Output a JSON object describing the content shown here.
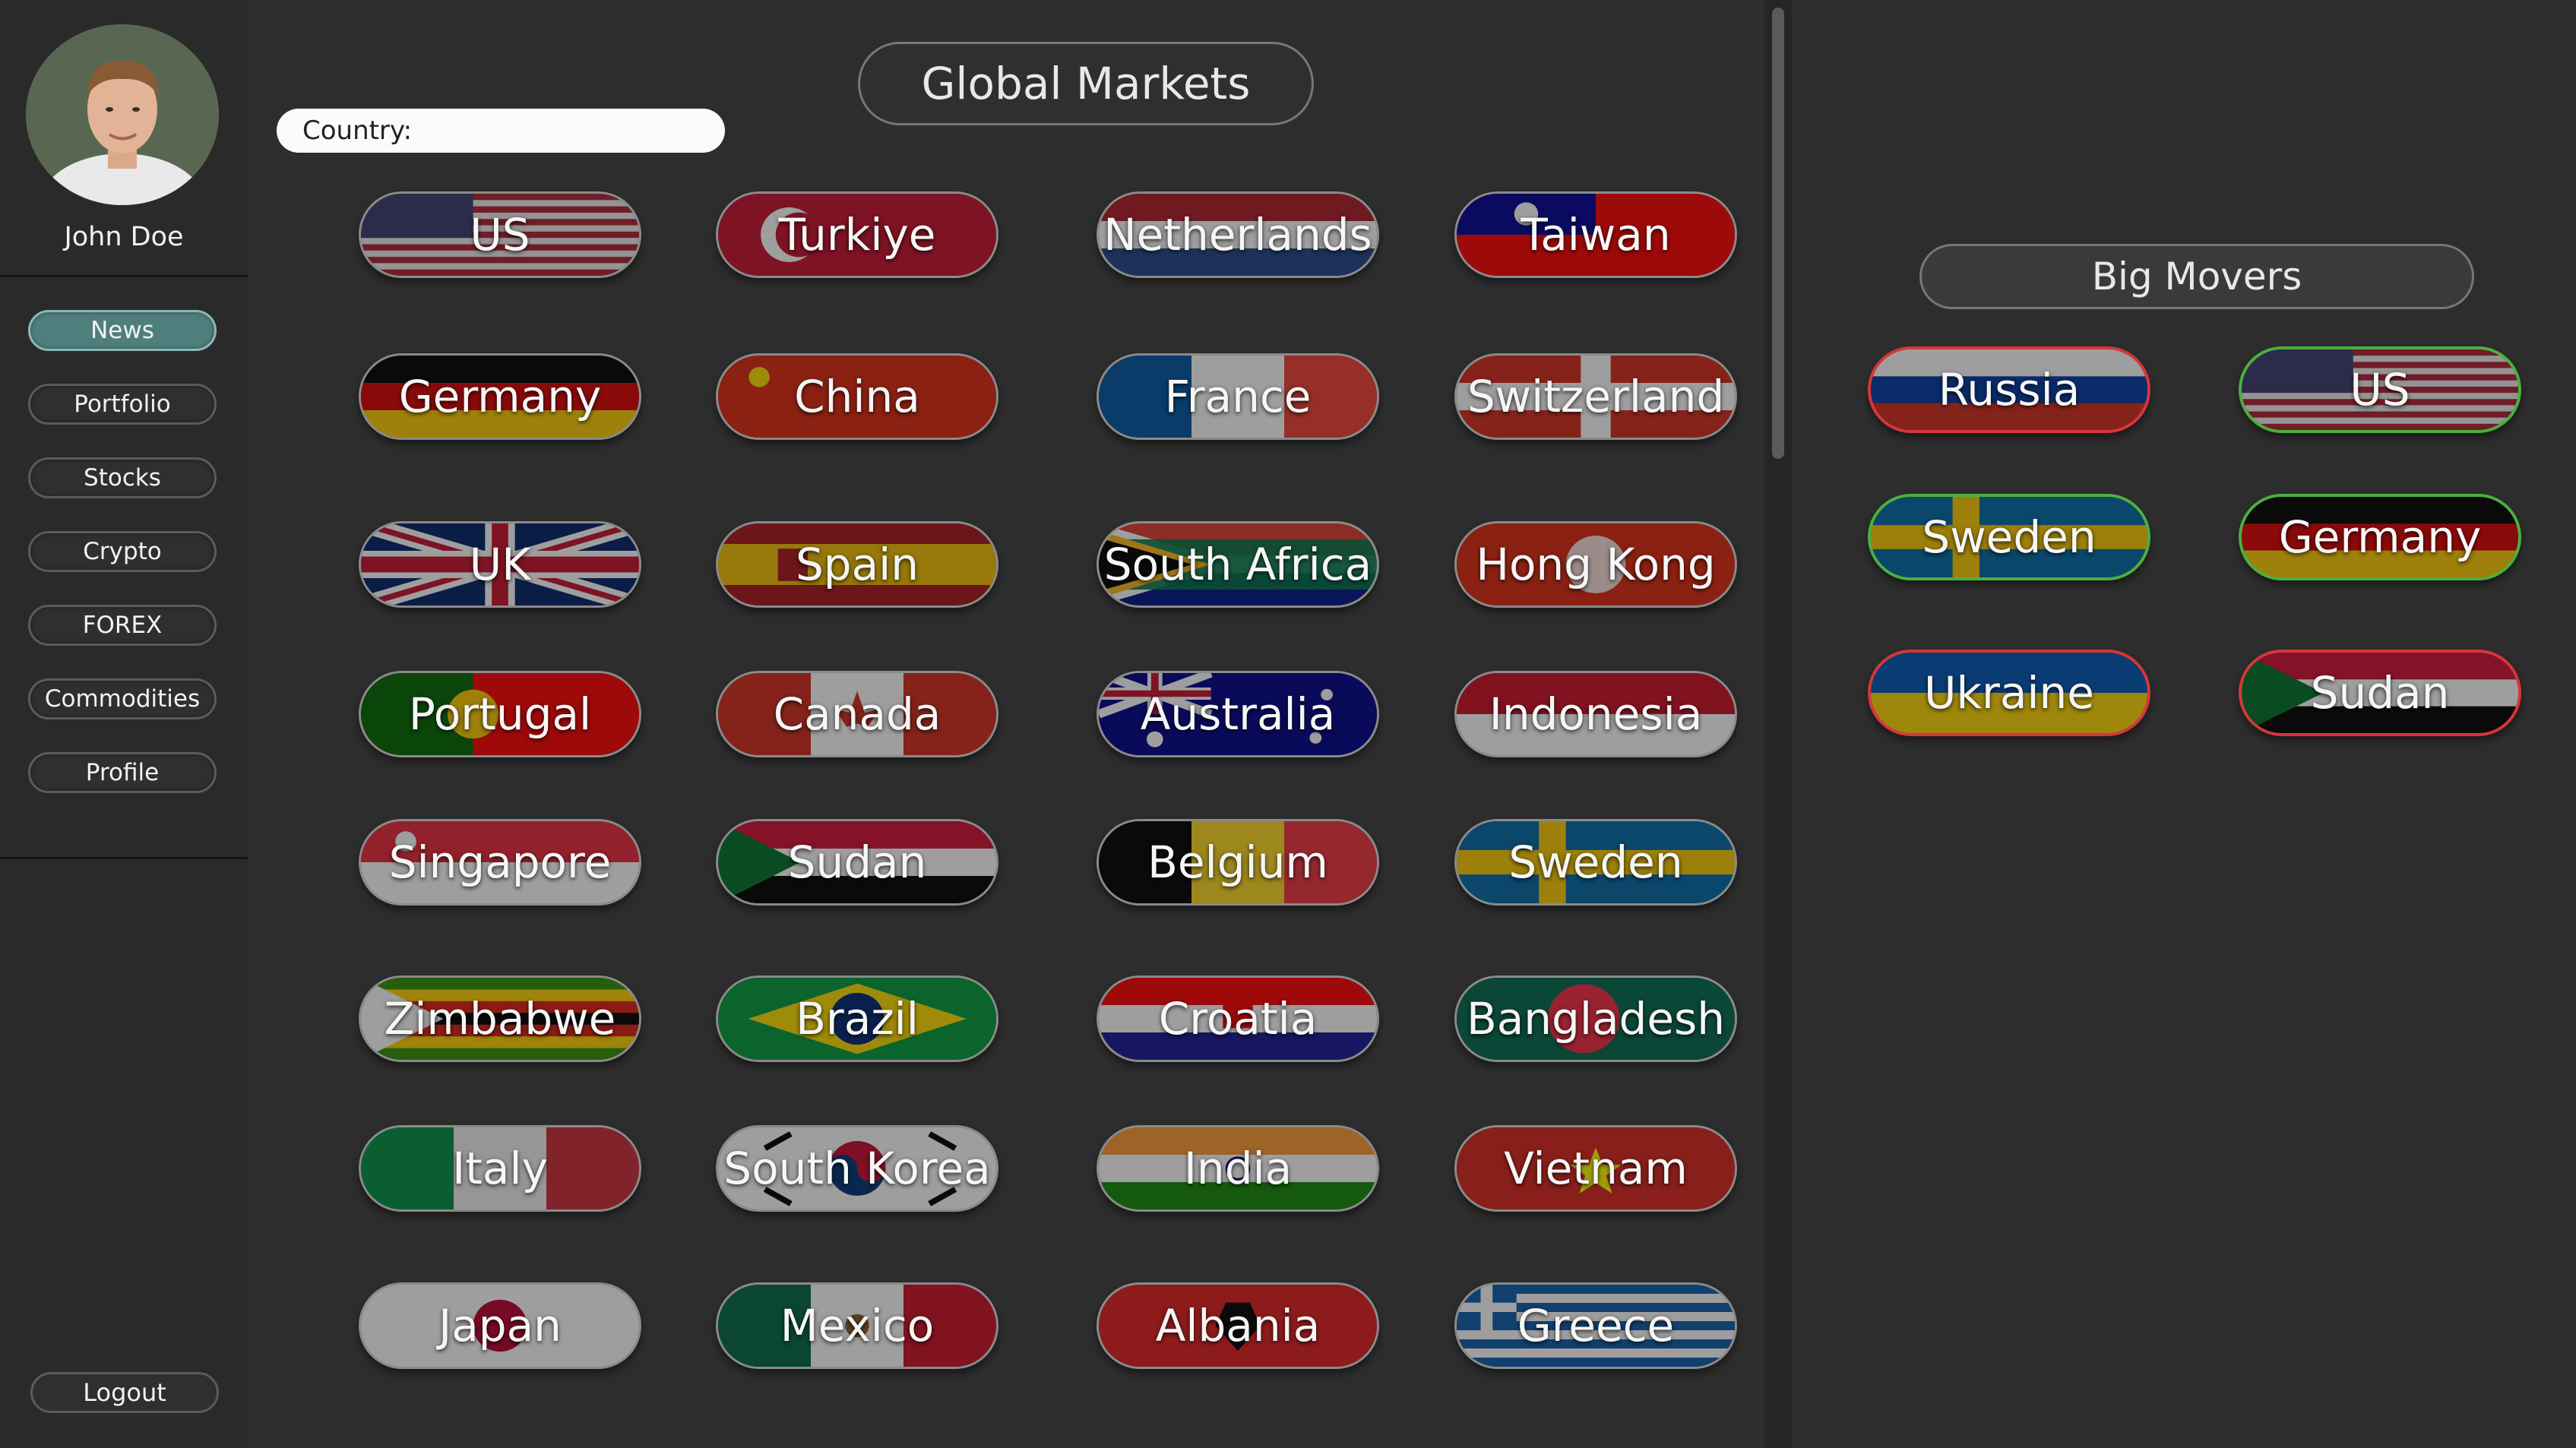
{
  "user": {
    "name": "John Doe"
  },
  "nav": {
    "items": [
      {
        "label": "News",
        "active": true
      },
      {
        "label": "Portfolio",
        "active": false
      },
      {
        "label": "Stocks",
        "active": false
      },
      {
        "label": "Crypto",
        "active": false
      },
      {
        "label": "FOREX",
        "active": false
      },
      {
        "label": "Commodities",
        "active": false
      },
      {
        "label": "Profile",
        "active": false
      }
    ],
    "logout_label": "Logout"
  },
  "global": {
    "title": "Global Markets",
    "search": {
      "label": "Country:",
      "value": "",
      "placeholder": ""
    },
    "countries": [
      "US",
      "Turkiye",
      "Netherlands",
      "Taiwan",
      "Germany",
      "China",
      "France",
      "Switzerland",
      "UK",
      "Spain",
      "South Africa",
      "Hong Kong",
      "Portugal",
      "Canada",
      "Australia",
      "Indonesia",
      "Singapore",
      "Sudan",
      "Belgium",
      "Sweden",
      "Zimbabwe",
      "Brazil",
      "Croatia",
      "Bangladesh",
      "Italy",
      "South Korea",
      "India",
      "Vietnam",
      "Japan",
      "Mexico",
      "Albania",
      "Greece"
    ]
  },
  "movers": {
    "title": "Big Movers",
    "items": [
      {
        "label": "Russia",
        "direction": "down"
      },
      {
        "label": "US",
        "direction": "up"
      },
      {
        "label": "Sweden",
        "direction": "up"
      },
      {
        "label": "Germany",
        "direction": "up"
      },
      {
        "label": "Ukraine",
        "direction": "down"
      },
      {
        "label": "Sudan",
        "direction": "down"
      }
    ]
  },
  "colors": {
    "up": "#4caf3f",
    "down": "#d6363a",
    "active_nav": "#4f7f7d"
  }
}
